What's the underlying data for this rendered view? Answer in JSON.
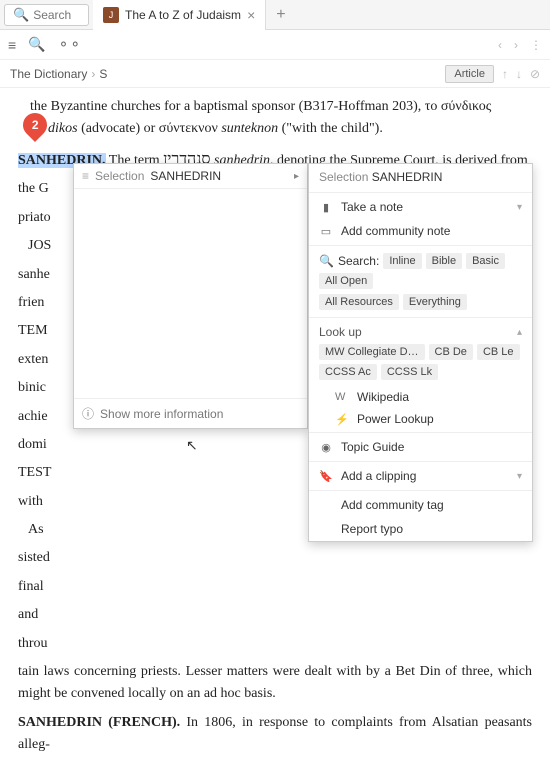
{
  "tabbar": {
    "search_placeholder": "Search",
    "tab_title": "The A to Z of Judaism",
    "favicon_text": "J"
  },
  "breadcrumb": {
    "part1": "The Dictionary",
    "part2": "S",
    "article_label": "Article"
  },
  "content": {
    "line1a": "the Byzantine churches for a baptismal sponsor (B317-Hoffman 203), το σύνδικος ",
    "line1b_italic": "dikos",
    "line1c": " (advocate) or σύντεκνον ",
    "line1d_italic": "sunteknon",
    "line1e": " (\"with the child\").",
    "sanhedrin": "SANHEDRIN.",
    "line2a": " The term ",
    "hebrew": "סנהדרין",
    "line2b_italic": " sanhedrin,",
    "line2c": " denoting the Supreme Court, is derived from",
    "line3": "the G",
    "filler1": "priato",
    "filler2": "JOS",
    "filler3": "sanhe",
    "filler4": "frien",
    "filler5": "TEM",
    "filler6": "exten",
    "filler7": "binic",
    "filler8": "achie",
    "filler9": "domi",
    "filler10": "TEST",
    "filler11": "with",
    "filler12": "As",
    "filler13": "sisted",
    "filler14": "final",
    "filler15": "and",
    "filler16": "throu",
    "tail1": "tain laws concerning priests. Lesser matters were dealt with by a Bet Din of three, which might be convened locally on an ad hoc basis.",
    "tail2a": "SANHEDRIN (FRENCH).",
    "tail2b": " In 1806, in response to complaints from Alsatian peasants alleg-"
  },
  "pin": {
    "number": "2"
  },
  "popover_left": {
    "selection_label": "Selection",
    "term": "SANHEDRIN",
    "more_info": "Show more information"
  },
  "popover_right": {
    "selection_label": "Selection",
    "term": "SANHEDRIN",
    "take_note": "Take a note",
    "add_community_note": "Add community note",
    "search_label": "Search:",
    "search_tags": [
      "Inline",
      "Bible",
      "Basic",
      "All Open",
      "All Resources",
      "Everything"
    ],
    "lookup_label": "Look up",
    "lookup_tags": [
      "MW Collegiate D…",
      "CB De",
      "CB Le",
      "CCSS Ac",
      "CCSS Lk"
    ],
    "wikipedia": "Wikipedia",
    "power_lookup": "Power Lookup",
    "topic_guide": "Topic Guide",
    "add_clipping": "Add a clipping",
    "add_community_tag": "Add community tag",
    "report_typo": "Report typo"
  }
}
